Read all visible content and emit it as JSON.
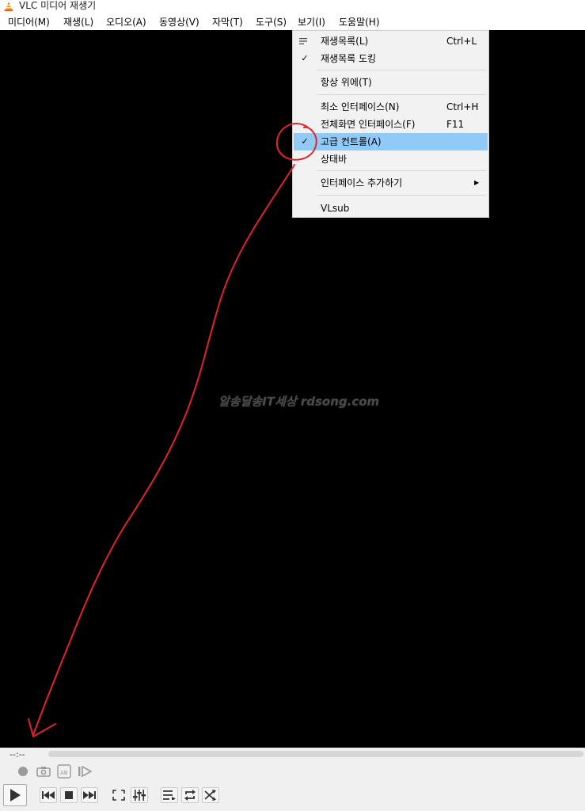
{
  "window": {
    "title": "VLC 미디어 재생기"
  },
  "menubar": {
    "items": [
      {
        "label": "미디어(M)"
      },
      {
        "label": "재생(L)"
      },
      {
        "label": "오디오(A)"
      },
      {
        "label": "동영상(V)"
      },
      {
        "label": "자막(T)"
      },
      {
        "label": "도구(S)"
      },
      {
        "label": "보기(I)"
      },
      {
        "label": "도움말(H)"
      }
    ],
    "open_menu": "보기(I)"
  },
  "view_menu": {
    "items": [
      {
        "label": "재생목록(L)",
        "shortcut": "Ctrl+L",
        "icon": "playlist-icon"
      },
      {
        "label": "재생목록 도킹",
        "shortcut": "",
        "checked": true
      },
      {
        "label": "항상 위에(T)",
        "shortcut": ""
      },
      {
        "label": "최소 인터페이스(N)",
        "shortcut": "Ctrl+H"
      },
      {
        "label": "전체화면 인터페이스(F)",
        "shortcut": "F11"
      },
      {
        "label": "고급 컨트롤(A)",
        "shortcut": "",
        "checked": true,
        "highlighted": true
      },
      {
        "label": "상태바",
        "shortcut": ""
      },
      {
        "label": "인터페이스 추가하기",
        "shortcut": "",
        "submenu": true
      },
      {
        "label": "VLsub",
        "shortcut": ""
      }
    ]
  },
  "video": {
    "watermark": "알송달송IT세상 rdsong.com"
  },
  "controls": {
    "time": "--:--",
    "advanced": [
      "record-icon",
      "snapshot-icon",
      "ab-loop-icon",
      "frame-step-icon"
    ],
    "main": [
      "play-icon",
      "previous-icon",
      "stop-icon",
      "next-icon",
      "fullscreen-icon",
      "extended-settings-icon",
      "playlist-icon",
      "loop-icon",
      "shuffle-icon"
    ]
  },
  "colors": {
    "video_bg": "#000000",
    "menu_highlight": "#91c9f7",
    "annotation": "#e0242b",
    "vlc_orange": "#f28c1a"
  }
}
